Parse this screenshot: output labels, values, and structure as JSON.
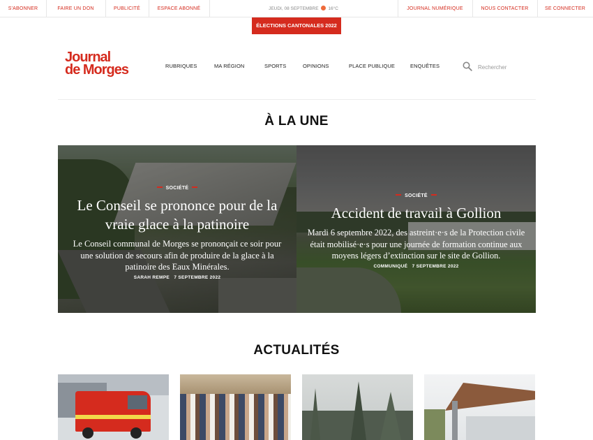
{
  "topbar": {
    "left": [
      "S'abonner",
      "Faire un don",
      "Publicité",
      "Espace abonné"
    ],
    "date": "Jeudi, 08 septembre",
    "weather": "16°C",
    "right": [
      "Journal numérique",
      "Nous contacter",
      "Se connecter"
    ]
  },
  "banner": "Élections cantonales 2022",
  "logo": {
    "line1": "Journal",
    "line2": "de Morges"
  },
  "nav": [
    "Rubriques",
    "Ma région",
    "Sports",
    "Opinions",
    "Place publique",
    "Enquêtes"
  ],
  "search": {
    "placeholder": "Rechercher"
  },
  "sections": {
    "une": "À LA UNE",
    "actualites": "ACTUALITÉS"
  },
  "hero": [
    {
      "category": "Société",
      "title": "Le Conseil se prononce pour de la vraie glace à la patinoire",
      "lede": "Le Conseil communal de Morges se prononçait ce soir pour une solution de secours afin de produire de la glace à la patinoire des Eaux Minérales.",
      "author": "Sarah Rempe",
      "date": "7 septembre 2022"
    },
    {
      "category": "Société",
      "title": "Accident de travail à Gollion",
      "lede": "Mardi 6 septembre 2022, des astreint·e·s de la Protection civile était mobilisé·e·s pour une journée de formation continue aux moyens légers d’extinction sur le site de Gollion.",
      "author": "Communiqué",
      "date": "7 septembre 2022"
    }
  ],
  "colors": {
    "accent": "#d52b1e",
    "weather_dot": "#ee6b3b"
  }
}
